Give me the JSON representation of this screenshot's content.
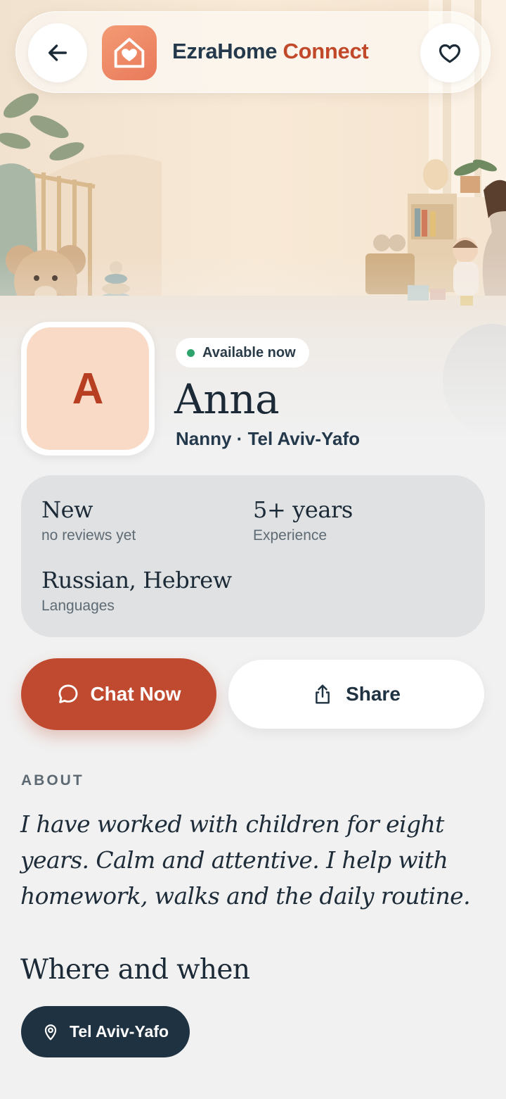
{
  "app": {
    "brand_part1": "EzraHome",
    "brand_part2": "Connect"
  },
  "header": {
    "back_icon": "arrow-left-icon",
    "favorite_icon": "heart-outline-icon",
    "logo_icon": "home-heart-icon"
  },
  "profile": {
    "initial": "A",
    "status": "Available now",
    "name": "Anna",
    "role_location": "Nanny · Tel Aviv-Yafo"
  },
  "stats": {
    "rating_value": "New",
    "rating_label": "no reviews yet",
    "experience_value": "5+ years",
    "experience_label": "Experience",
    "languages_value": "Russian, Hebrew",
    "languages_label": "Languages"
  },
  "actions": {
    "chat_label": "Chat Now",
    "chat_icon": "chat-bubble-icon",
    "share_label": "Share",
    "share_icon": "share-icon"
  },
  "about": {
    "heading": "ABOUT",
    "text": "I have worked with children for eight years. Calm and attentive. I help with homework, walks and the daily routine."
  },
  "where_when": {
    "heading": "Where and when",
    "location": "Tel Aviv-Yafo",
    "location_icon": "map-pin-icon"
  },
  "colors": {
    "accent": "#c04a30",
    "brand_dark": "#24394b",
    "status_green": "#2ea36c",
    "avatar_bg": "#f8dac6"
  }
}
